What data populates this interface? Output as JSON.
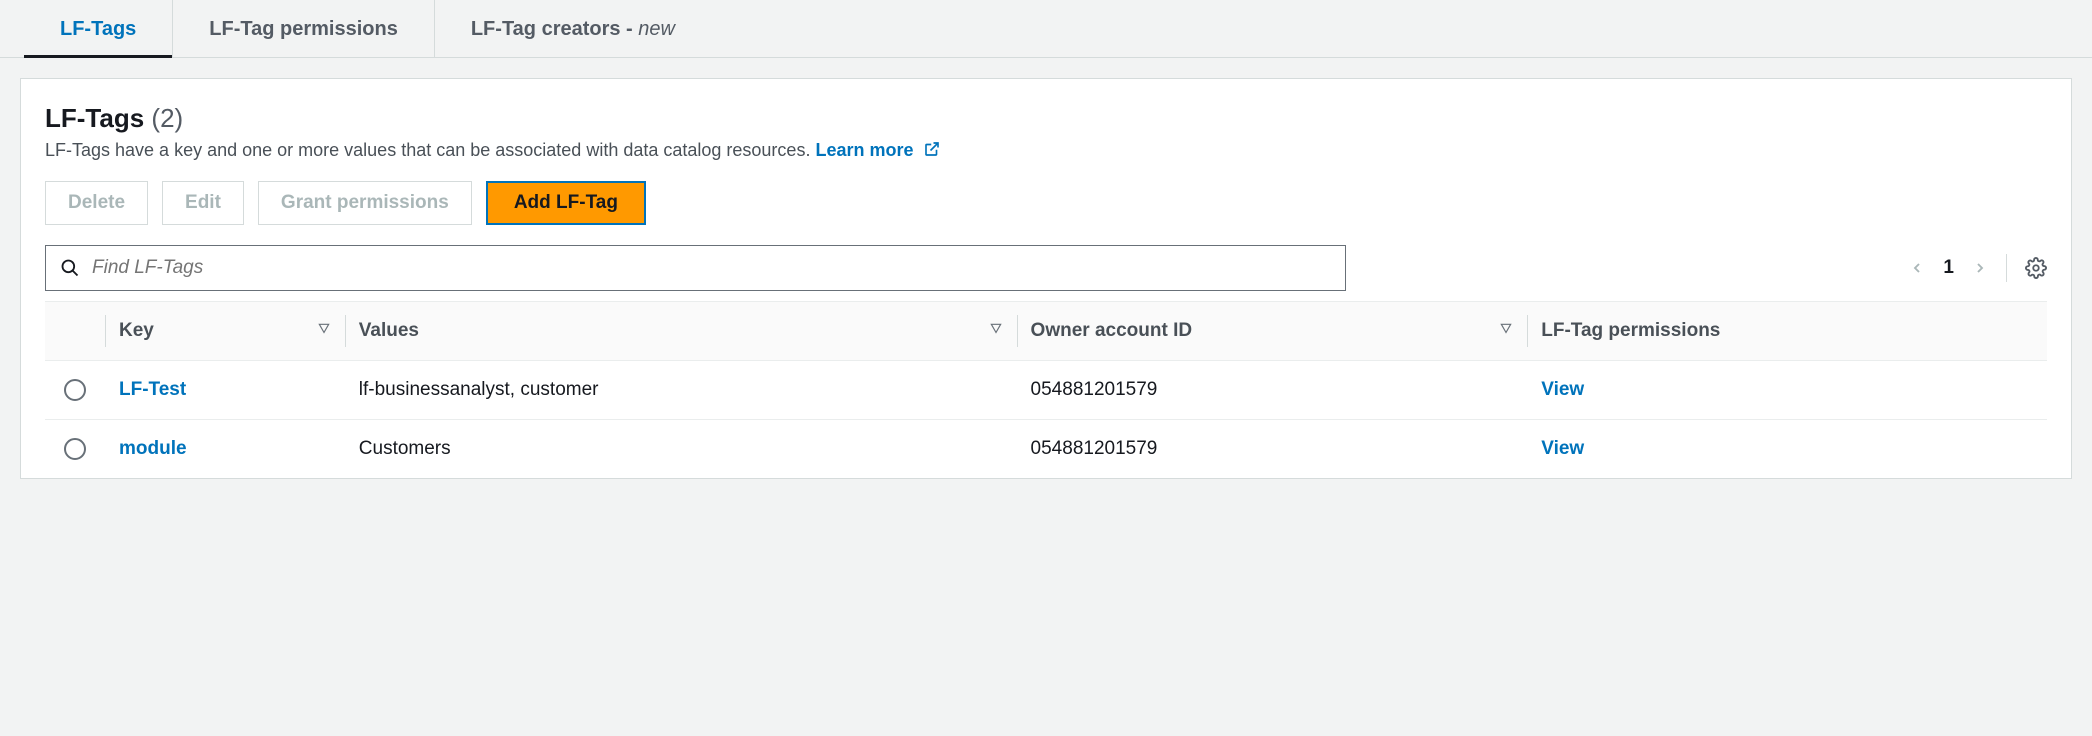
{
  "tabs": {
    "lftags": "LF-Tags",
    "permissions": "LF-Tag permissions",
    "creators_prefix": "LF-Tag creators - ",
    "creators_suffix": "new"
  },
  "panel": {
    "title": "LF-Tags",
    "count": "(2)",
    "description": "LF-Tags have a key and one or more values that can be associated with data catalog resources.",
    "learn_more": "Learn more"
  },
  "toolbar": {
    "delete": "Delete",
    "edit": "Edit",
    "grant": "Grant permissions",
    "add": "Add LF-Tag"
  },
  "search": {
    "placeholder": "Find LF-Tags"
  },
  "pager": {
    "page": "1"
  },
  "columns": {
    "key": "Key",
    "values": "Values",
    "owner": "Owner account ID",
    "perm": "LF-Tag permissions"
  },
  "rows": [
    {
      "key": "LF-Test",
      "values": "lf-businessanalyst, customer",
      "owner": "054881201579",
      "perm": "View"
    },
    {
      "key": "module",
      "values": "Customers",
      "owner": "054881201579",
      "perm": "View"
    }
  ]
}
